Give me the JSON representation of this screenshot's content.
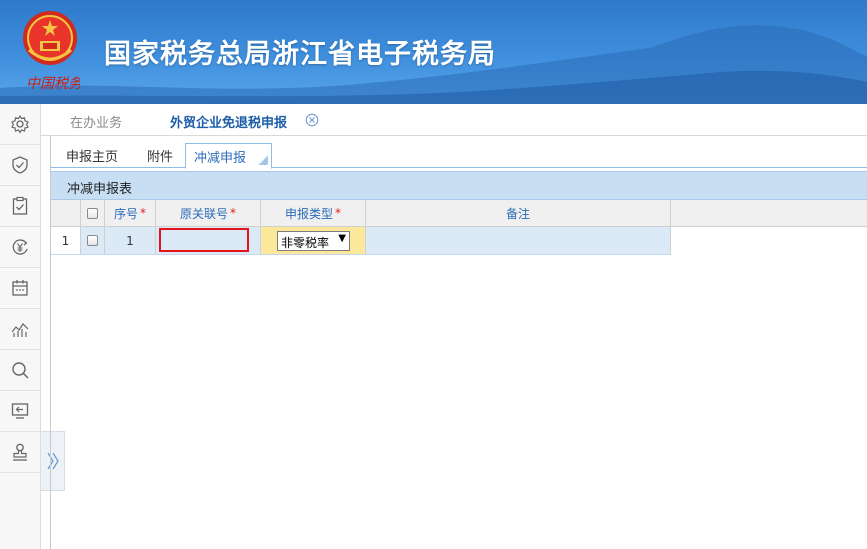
{
  "header": {
    "title": "国家税务总局浙江省电子税务局",
    "emblem_caption": "中国税务",
    "colors": {
      "banner_top": "#2f79c9",
      "banner_bottom": "#5aa6ea",
      "title_text": "#ffffff"
    }
  },
  "sidebar": {
    "items": [
      {
        "icon": "gear-icon"
      },
      {
        "icon": "shield-check-icon"
      },
      {
        "icon": "clipboard-check-icon"
      },
      {
        "icon": "yen-refund-icon"
      },
      {
        "icon": "calendar-icon"
      },
      {
        "icon": "chart-line-icon"
      },
      {
        "icon": "search-icon"
      },
      {
        "icon": "exit-screen-icon"
      },
      {
        "icon": "stamp-icon"
      }
    ],
    "expand_glyph": "»"
  },
  "top_tabs": [
    {
      "label": "在办业务",
      "active": false
    },
    {
      "label": "外贸企业免退税申报",
      "active": true,
      "closable": true
    }
  ],
  "sub_tabs": [
    {
      "label": "申报主页",
      "active": false
    },
    {
      "label": "附件",
      "active": false
    },
    {
      "label": "冲减申报",
      "active": true
    }
  ],
  "panel": {
    "title": "冲减申报表",
    "columns": [
      {
        "label": "序号",
        "required": true
      },
      {
        "label": "原关联号",
        "required": true
      },
      {
        "label": "申报类型",
        "required": true
      },
      {
        "label": "备注",
        "required": false
      }
    ],
    "required_mark": "*",
    "rows": [
      {
        "row_num": "1",
        "seq": "1",
        "original_ref": "",
        "decl_type": "非零税率",
        "remark": ""
      }
    ]
  },
  "colors": {
    "accent": "#2c6cb8",
    "required": "#e02020",
    "error_border": "#e3141b",
    "row_bg": "#dceaf8",
    "type_cell_bg": "#fbe89a"
  }
}
